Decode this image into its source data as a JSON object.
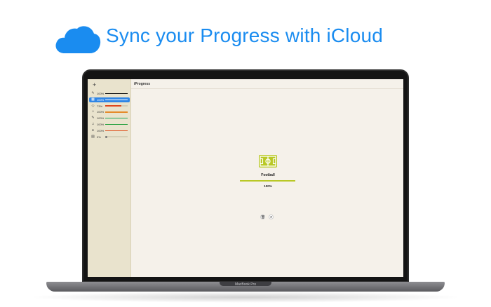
{
  "headline": "Sync your Progress with iCloud",
  "icons": {
    "cloud": "icloud-cloud-icon",
    "add": "plus-icon",
    "field": "football-field-icon",
    "delete": "trash-icon",
    "reset": "reset-icon"
  },
  "device_label": "MacBook Pro",
  "app": {
    "title": "iProgress",
    "add_label": "+",
    "sidebar_items": [
      {
        "icon": "✎",
        "icon_name": "pen-icon",
        "percent": "100%",
        "progress": 1.0,
        "color": "#111111"
      },
      {
        "icon": "▦",
        "icon_name": "football-icon",
        "percent": "100%",
        "progress": 1.0,
        "color": "#ffffff",
        "selected": true
      },
      {
        "icon": "◇",
        "icon_name": "diamond-icon",
        "percent": "73%",
        "progress": 0.73,
        "color": "#e0461c"
      },
      {
        "icon": "☼",
        "icon_name": "sun-icon",
        "percent": "100%",
        "progress": 1.0,
        "color": "#e58b2a"
      },
      {
        "icon": "✎",
        "icon_name": "pencil-icon",
        "percent": "100%",
        "progress": 1.0,
        "color": "#1fa55a"
      },
      {
        "icon": "♫",
        "icon_name": "music-icon",
        "percent": "100%",
        "progress": 1.0,
        "color": "#1f9e3a"
      },
      {
        "icon": "●",
        "icon_name": "target-icon",
        "percent": "100%",
        "progress": 1.0,
        "color": "#e05b2a"
      },
      {
        "icon": "▤",
        "icon_name": "book-icon",
        "percent": "0%",
        "progress": 0.0,
        "color": "#bbbbbb"
      }
    ],
    "detail": {
      "title": "Football",
      "percent": "100%",
      "progress": 1.0,
      "accent": "#b9c826"
    },
    "actions": {
      "delete": "🗑",
      "reset": "↺"
    }
  }
}
